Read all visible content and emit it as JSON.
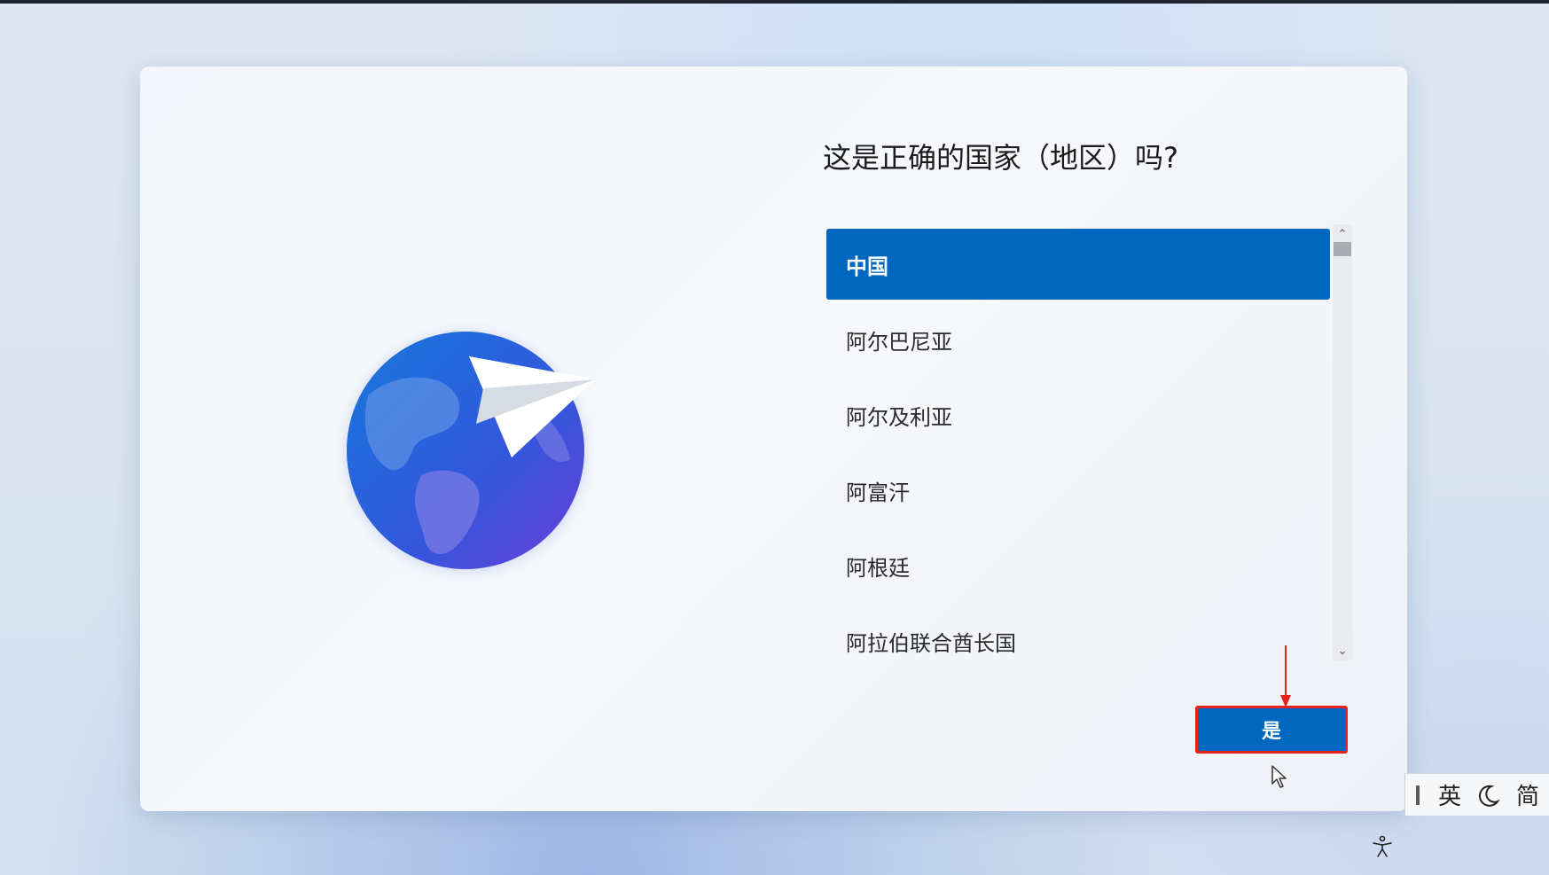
{
  "dialog": {
    "title": "这是正确的国家（地区）吗?",
    "countries": [
      {
        "label": "中国",
        "selected": true
      },
      {
        "label": "阿尔巴尼亚",
        "selected": false
      },
      {
        "label": "阿尔及利亚",
        "selected": false
      },
      {
        "label": "阿富汗",
        "selected": false
      },
      {
        "label": "阿根廷",
        "selected": false
      },
      {
        "label": "阿拉伯联合酋长国",
        "selected": false
      }
    ],
    "yes_label": "是"
  },
  "ime": {
    "lang_label": "英",
    "mode_icon": "moon-icon",
    "script_label": "简"
  },
  "colors": {
    "accent": "#0067c0",
    "annotation": "#e8211a"
  }
}
